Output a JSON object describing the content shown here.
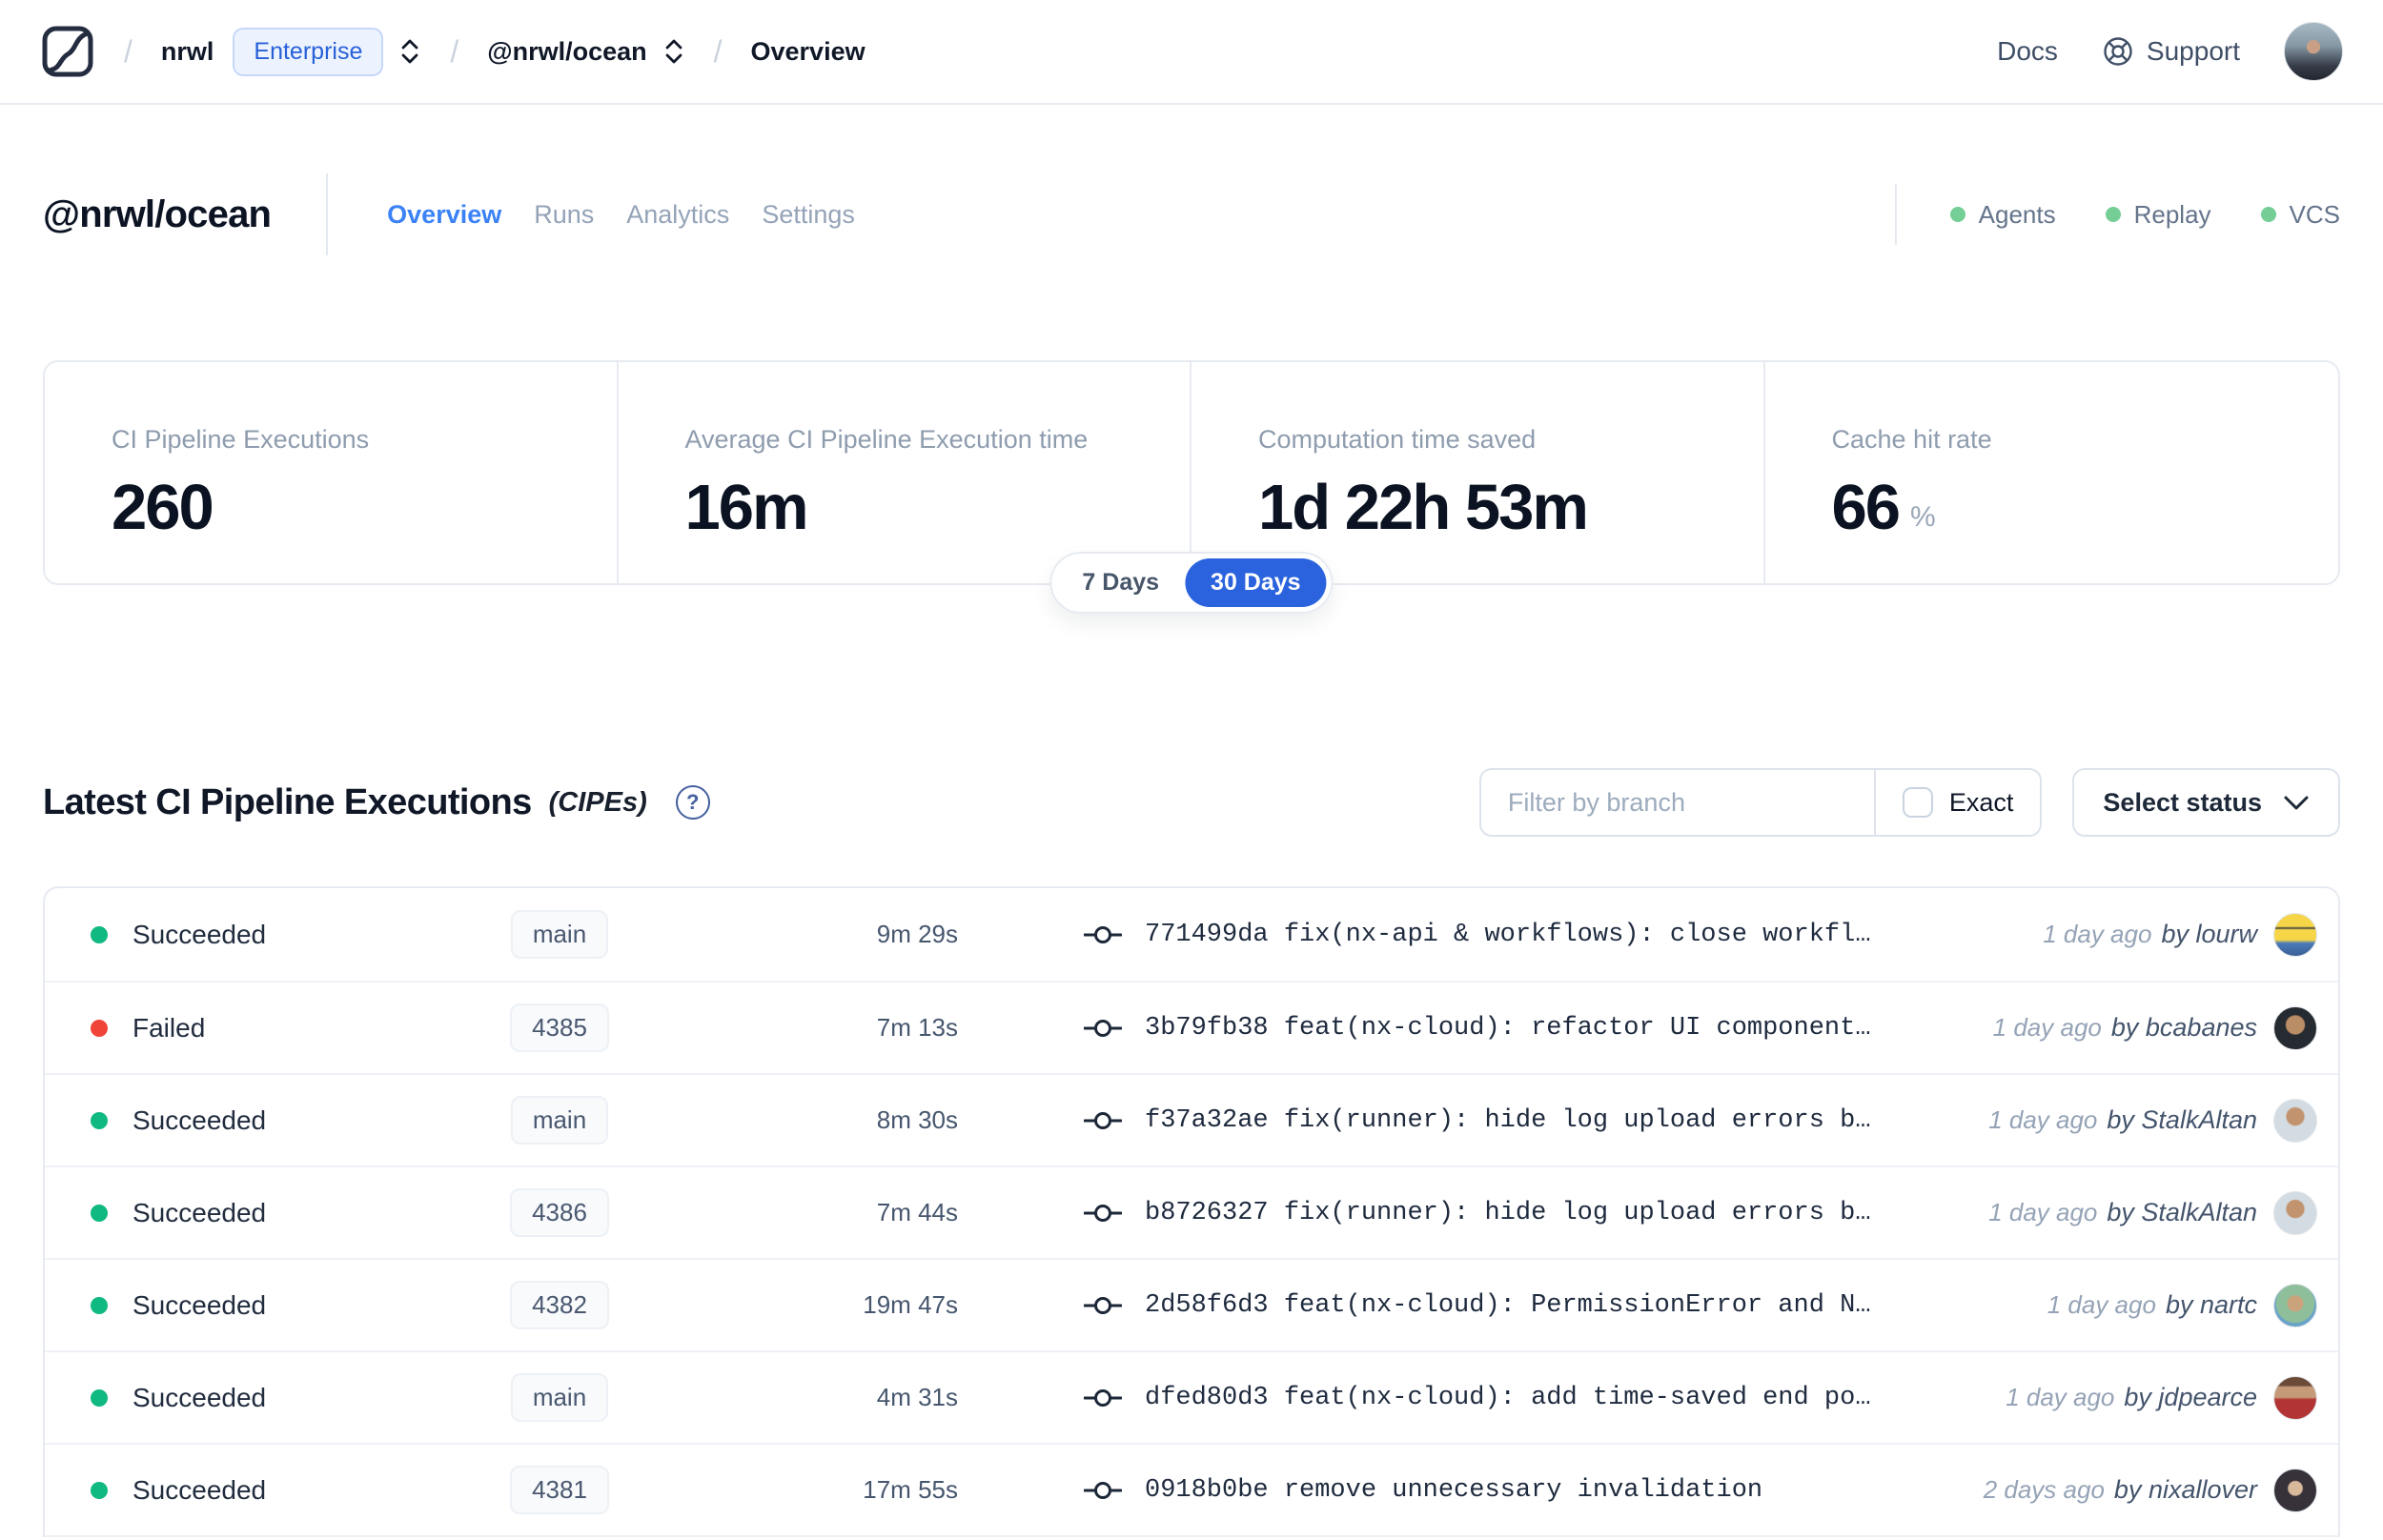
{
  "nav": {
    "breadcrumb": {
      "org": "nrwl",
      "org_badge": "Enterprise",
      "workspace": "@nrwl/ocean",
      "page": "Overview"
    },
    "docs_label": "Docs",
    "support_label": "Support"
  },
  "header": {
    "workspace_name": "@nrwl/ocean",
    "tabs": [
      {
        "label": "Overview",
        "active": true
      },
      {
        "label": "Runs",
        "active": false
      },
      {
        "label": "Analytics",
        "active": false
      },
      {
        "label": "Settings",
        "active": false
      }
    ],
    "services": [
      {
        "label": "Agents"
      },
      {
        "label": "Replay"
      },
      {
        "label": "VCS"
      }
    ],
    "services_dot_color": "#74ce96"
  },
  "stats": {
    "cards": [
      {
        "label": "CI Pipeline Executions",
        "value": "260"
      },
      {
        "label": "Average CI Pipeline Execution time",
        "value": "16m"
      },
      {
        "label": "Computation time saved",
        "value": "1d 22h 53m"
      },
      {
        "label": "Cache hit rate",
        "value": "66",
        "suffix": "%"
      }
    ],
    "range_toggle": {
      "options": [
        {
          "label": "7 Days",
          "active": false
        },
        {
          "label": "30 Days",
          "active": true
        }
      ],
      "active_bg": "#2a63dd"
    }
  },
  "cipes": {
    "title": "Latest CI Pipeline Executions",
    "title_suffix": "(CIPEs)",
    "help_glyph": "?",
    "filter": {
      "branch_placeholder": "Filter by branch",
      "exact_label": "Exact",
      "status_label": "Select status"
    },
    "rows": [
      {
        "status": "Succeeded",
        "status_color": "#10b981",
        "branch": "main",
        "duration": "9m 29s",
        "commit": "771499da fix(nx-api & workflows): close workfl…",
        "time": "1 day ago",
        "author": "by lourw",
        "avatar_css": "linear-gradient(180deg,#f6d648 0%,#f6d648 30%,#3a3d42 34%,#f6d648 38%,#f6d648 62%,#4a7ab8 70%,#3a5f96 100%)"
      },
      {
        "status": "Failed",
        "status_color": "#f04438",
        "branch": "4385",
        "duration": "7m 13s",
        "commit": "3b79fb38 feat(nx-cloud): refactor UI component…",
        "time": "1 day ago",
        "author": "by bcabanes",
        "avatar_css": "radial-gradient(circle at 50% 42%, #b98d66 0 28%, #262a31 32%)"
      },
      {
        "status": "Succeeded",
        "status_color": "#10b981",
        "branch": "main",
        "duration": "8m 30s",
        "commit": "f37a32ae fix(runner): hide log upload errors b…",
        "time": "1 day ago",
        "author": "by StalkAltan",
        "avatar_css": "radial-gradient(circle at 50% 40%, #c2936f 0 26%, #d3dce2 30%)"
      },
      {
        "status": "Succeeded",
        "status_color": "#10b981",
        "branch": "4386",
        "duration": "7m 44s",
        "commit": "b8726327 fix(runner): hide log upload errors b…",
        "time": "1 day ago",
        "author": "by StalkAltan",
        "avatar_css": "radial-gradient(circle at 50% 40%, #c2936f 0 26%, #d3dce2 30%)"
      },
      {
        "status": "Succeeded",
        "status_color": "#10b981",
        "branch": "4382",
        "duration": "19m 47s",
        "commit": "2d58f6d3 feat(nx-cloud): PermissionError and N…",
        "time": "1 day ago",
        "author": "by nartc",
        "avatar_css": "radial-gradient(circle at 50% 45%, #caa27c 0 24%, #8fbf9a 28% 60%, #6aa3c8 64%)"
      },
      {
        "status": "Succeeded",
        "status_color": "#10b981",
        "branch": "main",
        "duration": "4m 31s",
        "commit": "dfed80d3 feat(nx-cloud): add time-saved end po…",
        "time": "1 day ago",
        "author": "by jdpearce",
        "avatar_css": "linear-gradient(180deg,#6b4a38 0 20%,#c59a78 24% 48%,#b23434 54% 100%)"
      },
      {
        "status": "Succeeded",
        "status_color": "#10b981",
        "branch": "4381",
        "duration": "17m 55s",
        "commit": "0918b0be remove unnecessary invalidation",
        "time": "2 days ago",
        "author": "by nixallover",
        "avatar_css": "radial-gradient(circle at 50% 45%, #d8b99a 0 22%, #37313a 26%)"
      }
    ]
  },
  "colors": {
    "accent_blue": "#3b82f6",
    "success_green": "#10b981",
    "failed_red": "#f04438",
    "services_green": "#74ce96"
  }
}
